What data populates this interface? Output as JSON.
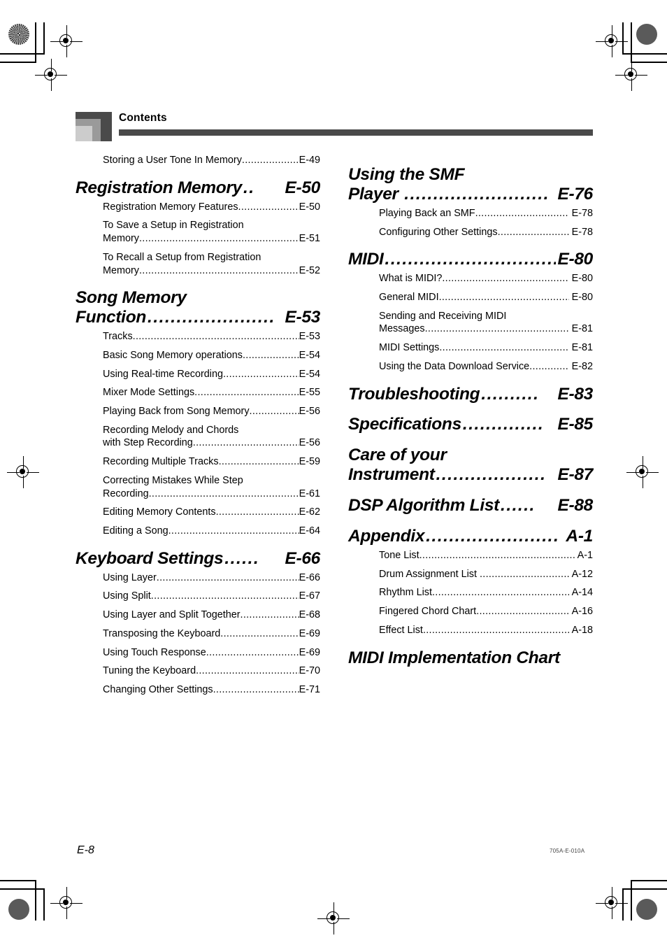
{
  "header": {
    "title": "Contents"
  },
  "footer": {
    "page_number": "E-8",
    "document_code": "705A-E-010A"
  },
  "leader_dots": "........................................................................................................",
  "columns": {
    "left": [
      {
        "kind": "entry",
        "lines": [
          "Storing a User Tone In Memory"
        ],
        "page": "E-49"
      },
      {
        "kind": "section",
        "lines": [
          "Registration Memory"
        ],
        "page": "E-50",
        "leader": ".."
      },
      {
        "kind": "entry",
        "lines": [
          "Registration Memory Features"
        ],
        "page": "E-50"
      },
      {
        "kind": "entry",
        "lines": [
          "To Save a Setup in Registration",
          "Memory"
        ],
        "page": "E-51"
      },
      {
        "kind": "entry",
        "lines": [
          "To Recall a Setup from Registration",
          "Memory"
        ],
        "page": "E-52"
      },
      {
        "kind": "section",
        "lines": [
          "Song Memory",
          "Function"
        ],
        "page": "E-53",
        "leader": "......................"
      },
      {
        "kind": "entry",
        "lines": [
          "Tracks"
        ],
        "page": "E-53"
      },
      {
        "kind": "entry",
        "lines": [
          "Basic Song Memory operations"
        ],
        "page": "E-54"
      },
      {
        "kind": "entry",
        "lines": [
          "Using Real-time Recording"
        ],
        "page": "E-54"
      },
      {
        "kind": "entry",
        "lines": [
          "Mixer Mode Settings"
        ],
        "page": "E-55"
      },
      {
        "kind": "entry",
        "lines": [
          "Playing Back from Song Memory"
        ],
        "page": "E-56"
      },
      {
        "kind": "entry",
        "lines": [
          "Recording Melody and Chords",
          "with Step Recording"
        ],
        "page": "E-56"
      },
      {
        "kind": "entry",
        "lines": [
          "Recording Multiple Tracks"
        ],
        "page": "E-59"
      },
      {
        "kind": "entry",
        "lines": [
          "Correcting Mistakes While Step",
          "Recording"
        ],
        "page": "E-61"
      },
      {
        "kind": "entry",
        "lines": [
          "Editing Memory Contents"
        ],
        "page": "E-62"
      },
      {
        "kind": "entry",
        "lines": [
          "Editing a Song"
        ],
        "page": "E-64"
      },
      {
        "kind": "section",
        "lines": [
          "Keyboard Settings"
        ],
        "page": "E-66",
        "leader": "......"
      },
      {
        "kind": "entry",
        "lines": [
          "Using Layer"
        ],
        "page": "E-66"
      },
      {
        "kind": "entry",
        "lines": [
          "Using Split"
        ],
        "page": "E-67"
      },
      {
        "kind": "entry",
        "lines": [
          "Using Layer and Split Together"
        ],
        "page": "E-68"
      },
      {
        "kind": "entry",
        "lines": [
          "Transposing the Keyboard"
        ],
        "page": "E-69"
      },
      {
        "kind": "entry",
        "lines": [
          "Using Touch Response"
        ],
        "page": "E-69"
      },
      {
        "kind": "entry",
        "lines": [
          "Tuning the Keyboard"
        ],
        "page": "E-70"
      },
      {
        "kind": "entry",
        "lines": [
          "Changing Other Settings"
        ],
        "page": "E-71"
      }
    ],
    "right": [
      {
        "kind": "section",
        "lines": [
          "Using the SMF",
          "Player "
        ],
        "page": "E-76",
        "leader": "........................."
      },
      {
        "kind": "entry",
        "lines": [
          "Playing Back an SMF"
        ],
        "page": "E-78"
      },
      {
        "kind": "entry",
        "lines": [
          "Configuring Other Settings"
        ],
        "page": "E-78"
      },
      {
        "kind": "section",
        "lines": [
          "MIDI"
        ],
        "page": "E-80",
        "leader": "..............................."
      },
      {
        "kind": "entry",
        "lines": [
          "What is MIDI?"
        ],
        "page": "E-80"
      },
      {
        "kind": "entry",
        "lines": [
          "General MIDI"
        ],
        "page": "E-80"
      },
      {
        "kind": "entry",
        "lines": [
          "Sending and Receiving MIDI",
          "Messages"
        ],
        "page": "E-81"
      },
      {
        "kind": "entry",
        "lines": [
          "MIDI Settings"
        ],
        "page": "E-81"
      },
      {
        "kind": "entry",
        "lines": [
          "Using the Data Download Service"
        ],
        "page": "E-82"
      },
      {
        "kind": "section",
        "lines": [
          "Troubleshooting"
        ],
        "page": "E-83",
        "leader": ".........."
      },
      {
        "kind": "section",
        "lines": [
          "Specifications"
        ],
        "page": "E-85",
        "leader": ".............."
      },
      {
        "kind": "section",
        "lines": [
          "Care of your",
          "Instrument"
        ],
        "page": "E-87",
        "leader": "..................."
      },
      {
        "kind": "section",
        "lines": [
          "DSP Algorithm List"
        ],
        "page": "E-88",
        "leader": "......"
      },
      {
        "kind": "section",
        "lines": [
          "Appendix"
        ],
        "page": "A-1",
        "leader": "......................."
      },
      {
        "kind": "entry",
        "lines": [
          "Tone List"
        ],
        "page": "A-1"
      },
      {
        "kind": "entry",
        "lines": [
          "Drum Assignment List "
        ],
        "page": "A-12"
      },
      {
        "kind": "entry",
        "lines": [
          "Rhythm List"
        ],
        "page": "A-14"
      },
      {
        "kind": "entry",
        "lines": [
          "Fingered Chord Chart"
        ],
        "page": "A-16"
      },
      {
        "kind": "entry",
        "lines": [
          "Effect List"
        ],
        "page": "A-18"
      },
      {
        "kind": "section",
        "lines": [
          "MIDI Implementation Chart"
        ],
        "page": "",
        "leader": ""
      }
    ]
  }
}
